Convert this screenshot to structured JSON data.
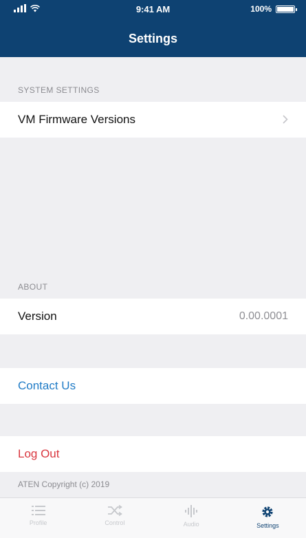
{
  "status_bar": {
    "time": "9:41 AM",
    "battery": "100%"
  },
  "header": {
    "title": "Settings"
  },
  "system_settings": {
    "header": "SYSTEM SETTINGS",
    "items": [
      {
        "label": "VM Firmware Versions",
        "icon": "chevron-right-icon"
      }
    ]
  },
  "about": {
    "header": "ABOUT",
    "version_label": "Version",
    "version_value": "0.00.0001"
  },
  "actions": {
    "contact": "Contact Us",
    "logout": "Log Out"
  },
  "copyright": "ATEN Copyright (c) 2019",
  "tabs": [
    {
      "label": "Profile",
      "icon": "list-icon",
      "active": false
    },
    {
      "label": "Control",
      "icon": "shuffle-icon",
      "active": false
    },
    {
      "label": "Audio",
      "icon": "audio-wave-icon",
      "active": false
    },
    {
      "label": "Settings",
      "icon": "gear-icon",
      "active": true
    }
  ],
  "colors": {
    "header": "#0e4272",
    "link": "#1f7bc6",
    "danger": "#d9363e",
    "background": "#efeff2"
  }
}
